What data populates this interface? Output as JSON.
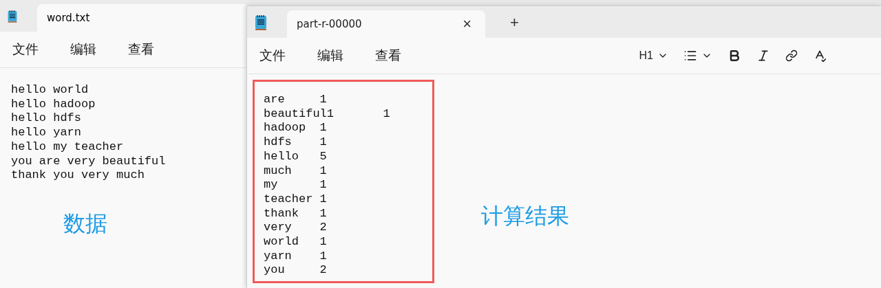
{
  "windows": [
    {
      "tab_title": "word.txt",
      "menu": [
        "文件",
        "编辑",
        "查看"
      ],
      "lines": [
        "hello world",
        "hello hadoop",
        "hello hdfs",
        "hello yarn",
        "hello my teacher",
        "you are very beautiful",
        "thank you very much"
      ],
      "note": "数据"
    },
    {
      "tab_title": "part-r-00000",
      "close": "×",
      "new_tab": "+",
      "menu": [
        "文件",
        "编辑",
        "查看"
      ],
      "heading": "H1",
      "lines": [
        "are     1",
        "beautiful1       1",
        "hadoop  1",
        "hdfs    1",
        "hello   5",
        "much    1",
        "my      1",
        "teacher 1",
        "thank   1",
        "very    2",
        "world   1",
        "yarn    1",
        "you     2"
      ],
      "note": "计算结果"
    }
  ]
}
